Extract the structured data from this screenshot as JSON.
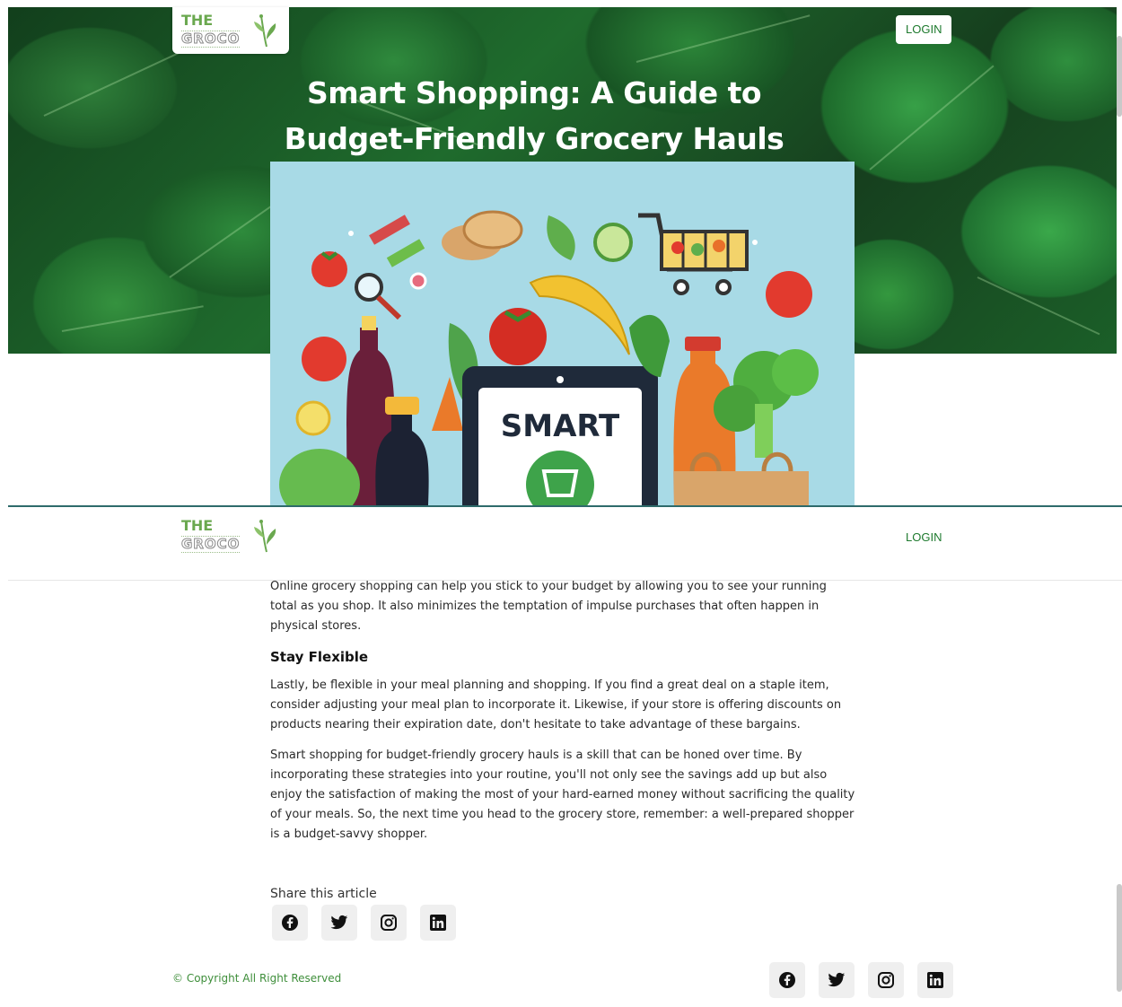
{
  "brand": {
    "logo_top": "THE",
    "logo_bottom": "GROCO"
  },
  "nav": {
    "login_label": "LOGIN"
  },
  "hero": {
    "title": "Smart Shopping: A Guide to Budget-Friendly Grocery Hauls",
    "image_text": "SMART"
  },
  "article": {
    "intro_paragraph": "Online grocery shopping can help you stick to your budget by allowing you to see your running total as you shop. It also minimizes the temptation of impulse purchases that often happen in physical stores.",
    "section_heading": "Stay Flexible",
    "flexible_paragraph": "Lastly, be flexible in your meal planning and shopping. If you find a great deal on a staple item, consider adjusting your meal plan to incorporate it. Likewise, if your store is offering discounts on products nearing their expiration date, don't hesitate to take advantage of these bargains.",
    "closing_paragraph": "Smart shopping for budget-friendly grocery hauls is a skill that can be honed over time. By incorporating these strategies into your routine, you'll not only see the savings add up but also enjoy the satisfaction of making the most of your hard-earned money without sacrificing the quality of your meals. So, the next time you head to the grocery store, remember: a well-prepared shopper is a budget-savvy shopper."
  },
  "share": {
    "label": "Share this article",
    "icons": [
      "facebook-icon",
      "twitter-icon",
      "instagram-icon",
      "linkedin-icon"
    ]
  },
  "footer": {
    "copyright": "© Copyright All Right Reserved"
  },
  "colors": {
    "brand_green": "#1e7a2e",
    "footer_green": "#3e8e3a",
    "hero_dark": "#1c5a27"
  }
}
